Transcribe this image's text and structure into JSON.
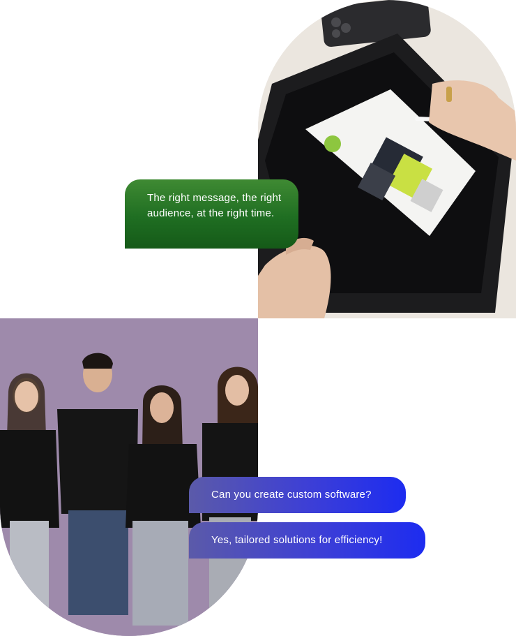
{
  "messages": {
    "tagline": "The right message, the right audience, at the right time.",
    "question": "Can you create custom software?",
    "answer": "Yes, tailored solutions for efficiency!"
  },
  "colors": {
    "tagline_bubble": "#1f6e22",
    "chat_bubble": "#1d2cf0",
    "bottom_backdrop": "#9e89ab",
    "top_backdrop": "#ece8e2"
  }
}
